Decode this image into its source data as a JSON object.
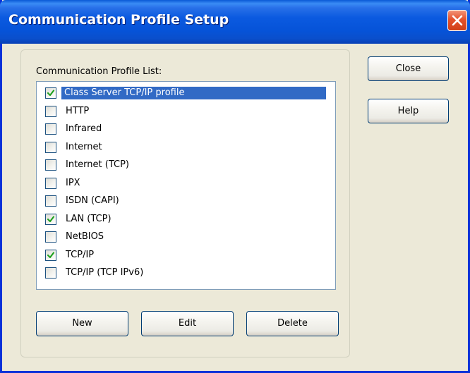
{
  "window": {
    "title": "Communication Profile Setup"
  },
  "group": {
    "label": "Communication Profile List:"
  },
  "profiles": [
    {
      "label": "Class Server TCP/IP profile",
      "checked": true,
      "selected": true
    },
    {
      "label": "HTTP",
      "checked": false,
      "selected": false
    },
    {
      "label": "Infrared",
      "checked": false,
      "selected": false
    },
    {
      "label": "Internet",
      "checked": false,
      "selected": false
    },
    {
      "label": "Internet (TCP)",
      "checked": false,
      "selected": false
    },
    {
      "label": "IPX",
      "checked": false,
      "selected": false
    },
    {
      "label": "ISDN (CAPI)",
      "checked": false,
      "selected": false
    },
    {
      "label": "LAN (TCP)",
      "checked": true,
      "selected": false
    },
    {
      "label": "NetBIOS",
      "checked": false,
      "selected": false
    },
    {
      "label": "TCP/IP",
      "checked": true,
      "selected": false
    },
    {
      "label": "TCP/IP (TCP IPv6)",
      "checked": false,
      "selected": false
    }
  ],
  "buttons": {
    "close": "Close",
    "help": "Help",
    "new": "New",
    "edit": "Edit",
    "delete": "Delete"
  },
  "colors": {
    "title_bar": "#0b5ae0",
    "selection": "#316ac5",
    "checkmark": "#21a121",
    "close_button": "#e4512b"
  },
  "icons": {
    "window_close": "close-x-icon",
    "checkbox_checked": "checkmark-icon"
  }
}
